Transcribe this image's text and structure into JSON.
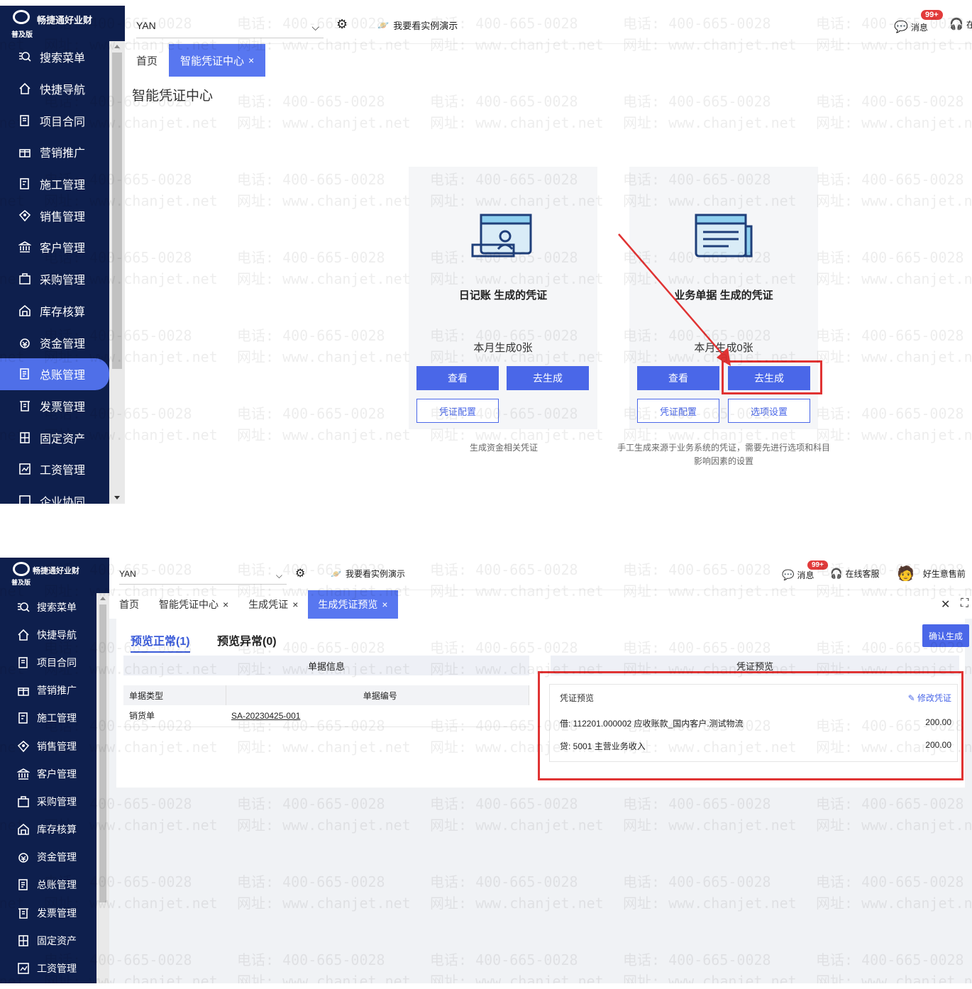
{
  "app": {
    "brand_name": "畅捷通好业财",
    "edition": "普及版",
    "org": "YAN",
    "demo_link": "我要看实例演示",
    "messages_label": "消息",
    "messages_badge": "99+",
    "online_service": "在线客服",
    "online_service_trunc": "在",
    "user_label": "好生意售前"
  },
  "watermark": {
    "phone": "电话: 400-665-0028",
    "site": "网址: www.chanjet.net"
  },
  "menu": [
    {
      "label": "搜索菜单",
      "icon": "search-menu-icon"
    },
    {
      "label": "快捷导航",
      "icon": "home-icon"
    },
    {
      "label": "项目合同",
      "icon": "contract-icon"
    },
    {
      "label": "营销推广",
      "icon": "gift-icon"
    },
    {
      "label": "施工管理",
      "icon": "construction-icon"
    },
    {
      "label": "销售管理",
      "icon": "sales-icon"
    },
    {
      "label": "客户管理",
      "icon": "bank-icon"
    },
    {
      "label": "采购管理",
      "icon": "bag-icon"
    },
    {
      "label": "库存核算",
      "icon": "warehouse-icon"
    },
    {
      "label": "资金管理",
      "icon": "money-icon"
    },
    {
      "label": "总账管理",
      "icon": "ledger-icon"
    },
    {
      "label": "发票管理",
      "icon": "invoice-icon"
    },
    {
      "label": "固定资产",
      "icon": "asset-icon"
    },
    {
      "label": "工资管理",
      "icon": "salary-icon"
    },
    {
      "label": "企业协同",
      "icon": "collab-icon"
    }
  ],
  "screen1": {
    "tabs": [
      {
        "label": "首页"
      },
      {
        "label": "智能凭证中心",
        "closable": "×"
      }
    ],
    "page_title": "智能凭证中心",
    "cards": [
      {
        "title": "日记账 生成的凭证",
        "count": "本月生成0张",
        "view_btn": "查看",
        "gen_btn": "去生成",
        "config_btn": "凭证配置",
        "desc": "生成资金相关凭证"
      },
      {
        "title": "业务单据 生成的凭证",
        "count": "本月生成0张",
        "view_btn": "查看",
        "gen_btn": "去生成",
        "config_btn": "凭证配置",
        "option_btn": "选项设置",
        "desc": "手工生成来源于业务系统的凭证，需要先进行选项和科目影响因素的设置"
      }
    ]
  },
  "screen2": {
    "tabs": [
      {
        "label": "首页"
      },
      {
        "label": "智能凭证中心",
        "closable": "×"
      },
      {
        "label": "生成凭证",
        "closable": "×"
      },
      {
        "label": "生成凭证预览",
        "closable": "×"
      }
    ],
    "subtabs": [
      "预览正常(1)",
      "预览异常(0)"
    ],
    "confirm_btn": "确认生成",
    "doc_section": "单据信息",
    "voucher_section": "凭证预览",
    "table": {
      "headers": [
        "单据类型",
        "单据编号"
      ],
      "rows": [
        [
          "销货单",
          "SA-20230425-001"
        ]
      ]
    },
    "voucher": {
      "head": "凭证预览",
      "edit": "修改凭证",
      "lines": [
        {
          "text": "借: 112201.000002 应收账款_国内客户.测试物流",
          "amount": "200.00"
        },
        {
          "text": "贷: 5001 主营业务收入",
          "amount": "200.00"
        }
      ]
    }
  }
}
